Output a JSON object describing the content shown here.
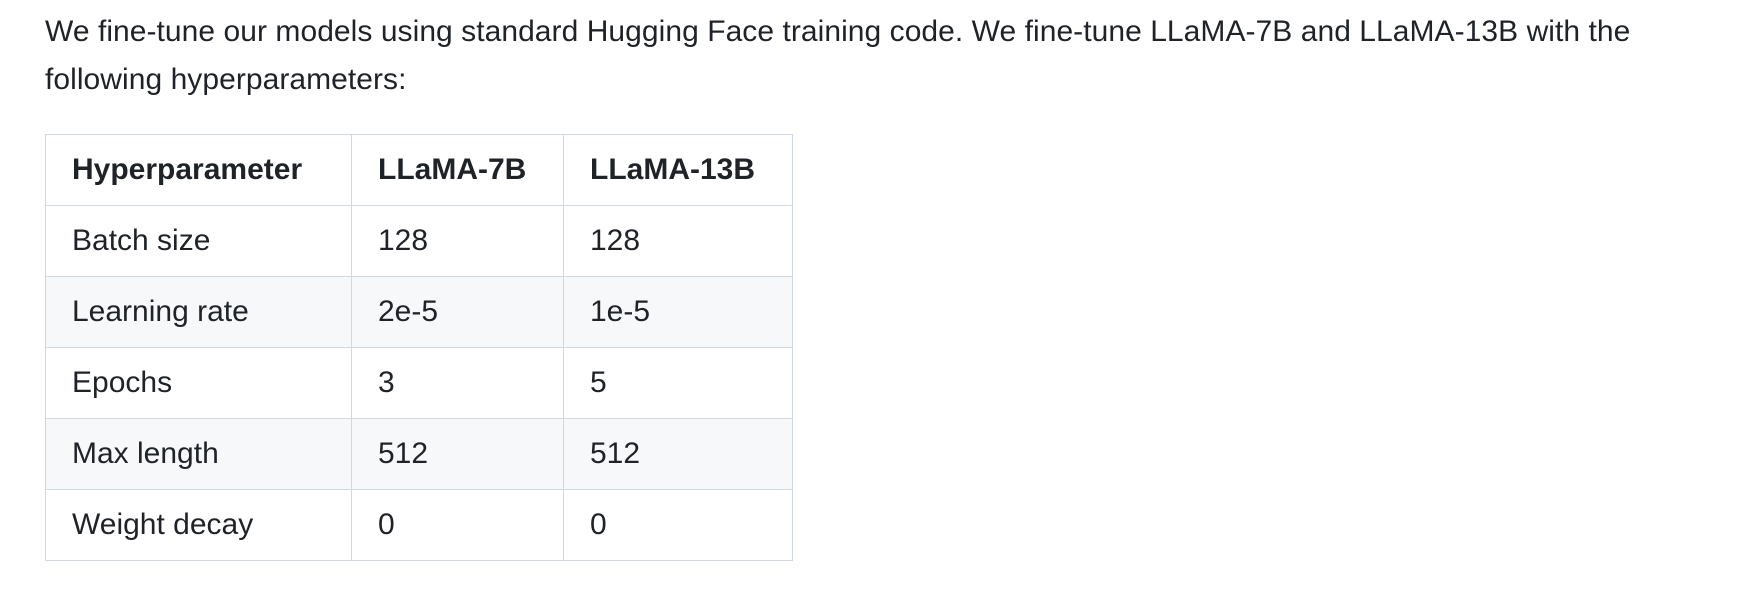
{
  "intro_text": "We fine-tune our models using standard Hugging Face training code. We fine-tune LLaMA-7B and LLaMA-13B with the following hyperparameters:",
  "table": {
    "headers": [
      "Hyperparameter",
      "LLaMA-7B",
      "LLaMA-13B"
    ],
    "rows": [
      [
        "Batch size",
        "128",
        "128"
      ],
      [
        "Learning rate",
        "2e-5",
        "1e-5"
      ],
      [
        "Epochs",
        "3",
        "5"
      ],
      [
        "Max length",
        "512",
        "512"
      ],
      [
        "Weight decay",
        "0",
        "0"
      ]
    ]
  },
  "colors": {
    "text": "#1f2328",
    "border": "#d1d9e0",
    "stripe": "#f6f8fa"
  }
}
